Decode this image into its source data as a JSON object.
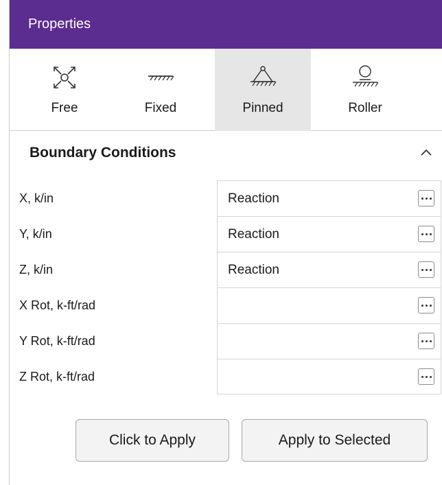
{
  "header": {
    "title": "Properties"
  },
  "toolbar": {
    "items": [
      {
        "label": "Free",
        "icon": "free-dof-icon"
      },
      {
        "label": "Fixed",
        "icon": "fixed-support-icon"
      },
      {
        "label": "Pinned",
        "icon": "pinned-support-icon",
        "selected": true
      },
      {
        "label": "Roller",
        "icon": "roller-support-icon"
      }
    ]
  },
  "section": {
    "title": "Boundary Conditions"
  },
  "rows": [
    {
      "label": "X, k/in",
      "value": "Reaction"
    },
    {
      "label": "Y, k/in",
      "value": "Reaction"
    },
    {
      "label": "Z, k/in",
      "value": "Reaction"
    },
    {
      "label": "X Rot, k-ft/rad",
      "value": ""
    },
    {
      "label": "Y Rot, k-ft/rad",
      "value": ""
    },
    {
      "label": "Z Rot, k-ft/rad",
      "value": ""
    }
  ],
  "buttons": {
    "click_to_apply": "Click to Apply",
    "apply_to_selected": "Apply to Selected"
  },
  "colors": {
    "header_bg": "#5b2d91",
    "selected_tool_bg": "#e6e6e6"
  }
}
